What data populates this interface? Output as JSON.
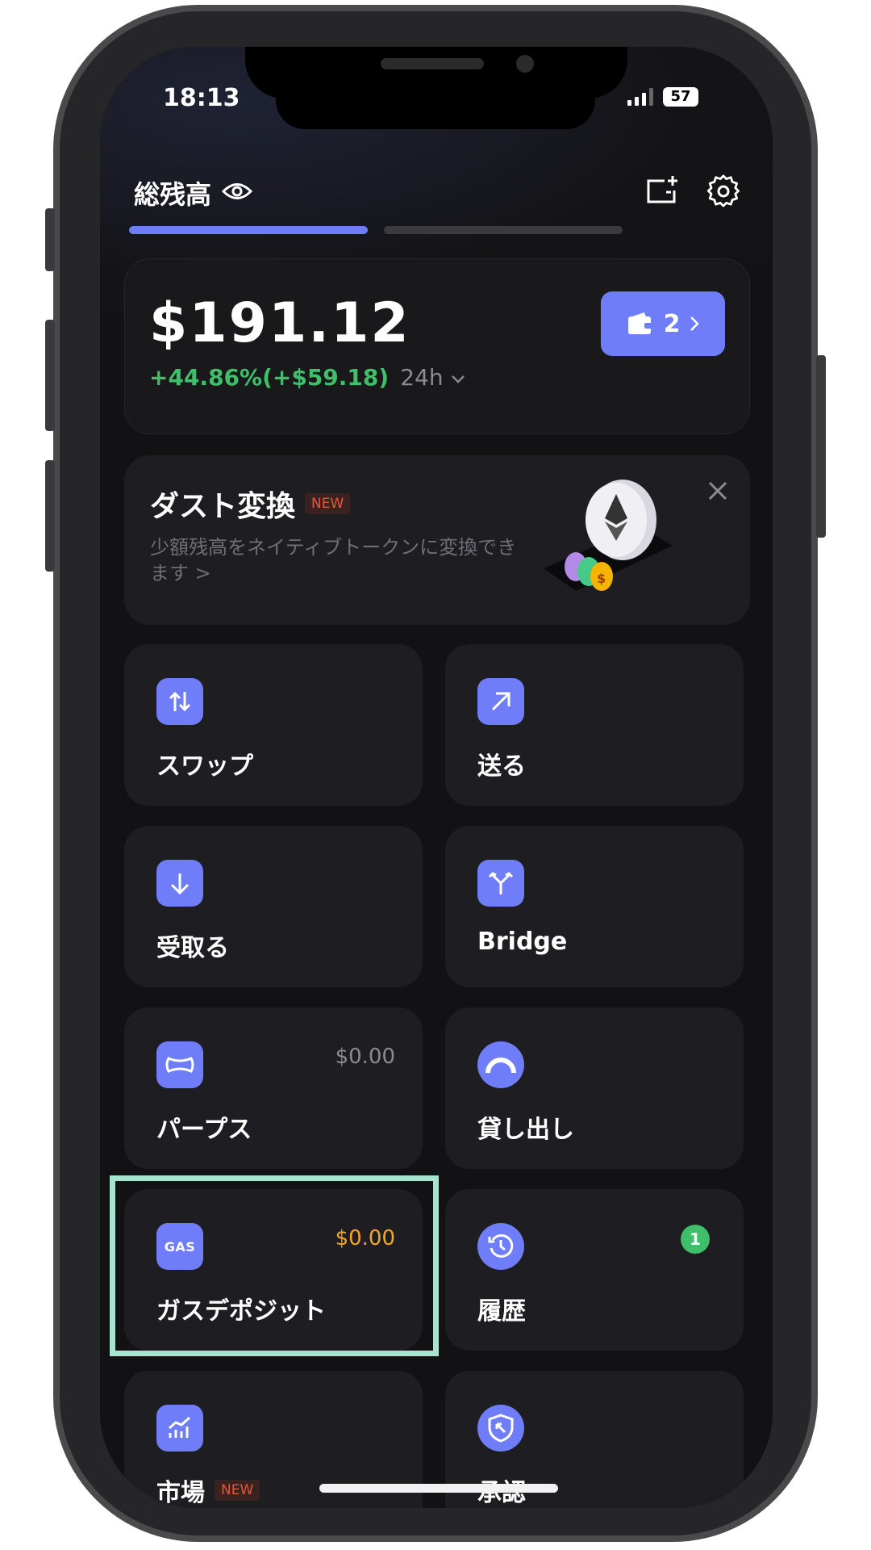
{
  "status_bar": {
    "time": "18:13",
    "battery": "57"
  },
  "header": {
    "title": "総残高"
  },
  "balance": {
    "amount": "$191.12",
    "change": "+44.86%(+$59.18)",
    "period": "24h",
    "wallet_count": "2"
  },
  "dust_banner": {
    "title": "ダスト変換",
    "badge": "NEW",
    "description": "少額残高をネイティブトークンに変換できます >"
  },
  "tiles": [
    {
      "label": "スワップ",
      "icon": "swap-icon"
    },
    {
      "label": "送る",
      "icon": "send-arrow-icon"
    },
    {
      "label": "受取る",
      "icon": "receive-arrow-icon"
    },
    {
      "label": "Bridge",
      "icon": "bridge-icon"
    },
    {
      "label": "パープス",
      "icon": "infinity-icon",
      "value": "$0.00"
    },
    {
      "label": "貸し出し",
      "icon": "gauge-icon"
    },
    {
      "label": "ガスデポジット",
      "icon": "gas-icon",
      "icon_text": "GAS",
      "value": "$0.00"
    },
    {
      "label": "履歴",
      "icon": "history-icon",
      "badge": "1"
    },
    {
      "label": "市場",
      "icon": "market-chart-icon",
      "badge": "NEW"
    },
    {
      "label": "承認",
      "icon": "shield-icon"
    }
  ],
  "colors": {
    "accent": "#6f7ef8",
    "positive": "#3fbf6a",
    "value_gray": "#8a8a92",
    "value_orange": "#f5a623",
    "badge_new": "#e05a3a",
    "highlight": "#a8e3cf"
  }
}
